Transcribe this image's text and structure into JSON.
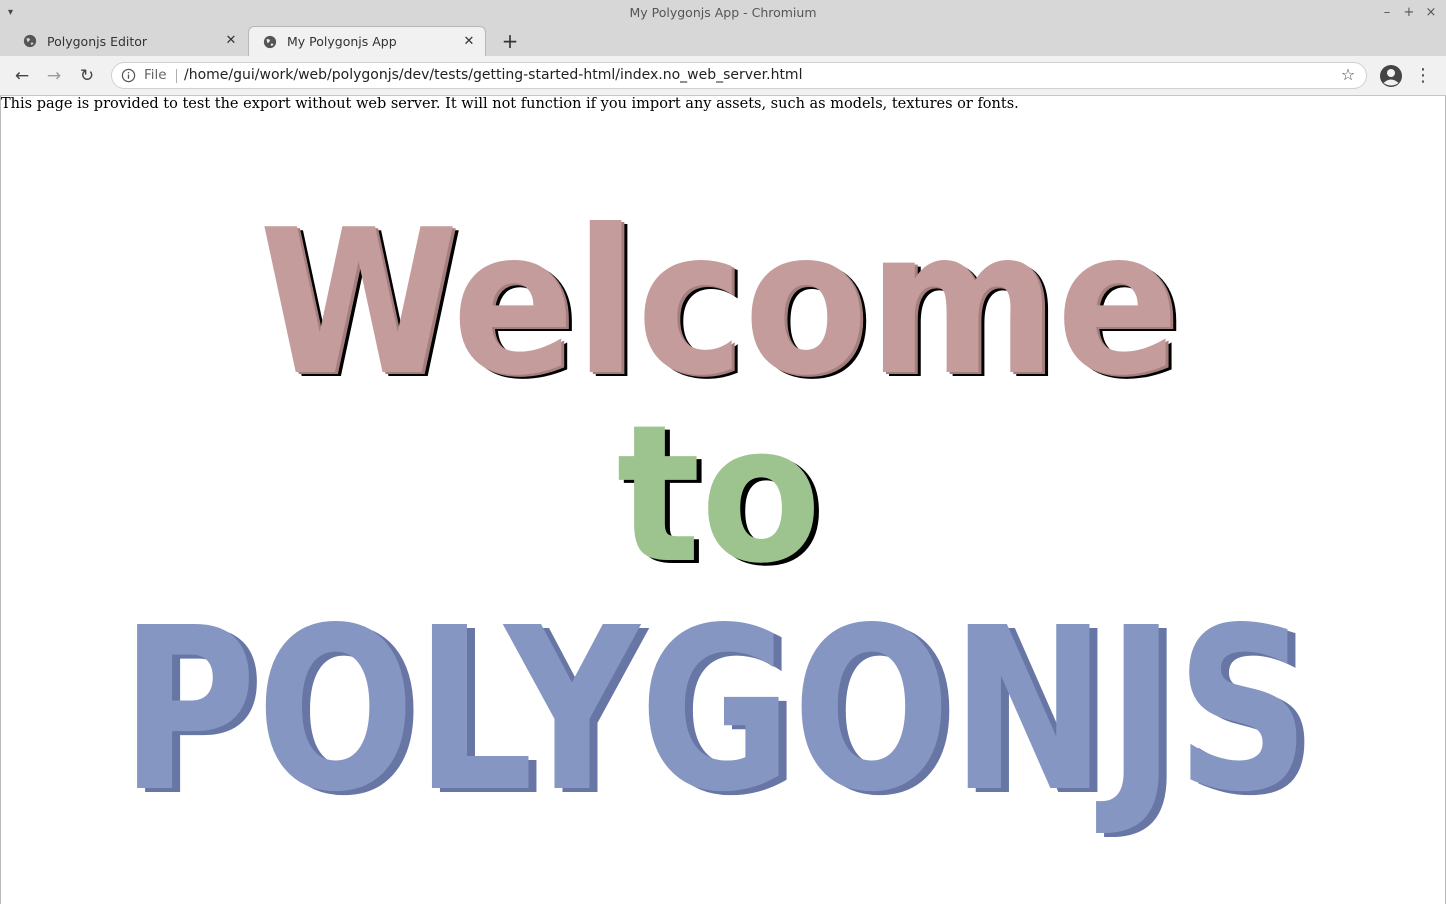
{
  "window": {
    "title": "My Polygonjs App - Chromium"
  },
  "tabs": [
    {
      "label": "Polygonjs Editor",
      "active": false
    },
    {
      "label": "My Polygonjs App",
      "active": true
    }
  ],
  "address_bar": {
    "scheme_label": "File",
    "url": "/home/gui/work/web/polygonjs/dev/tests/getting-started-html/index.no_web_server.html"
  },
  "page": {
    "notice": "This page is provided to test the export without web server. It will not function if you import any assets, such as models, textures or fonts.",
    "scene_words": [
      {
        "text": "Welcome",
        "color": "#c49c9c",
        "side": "#a57e7e"
      },
      {
        "text": "to",
        "color": "#9dc48f",
        "side": "#7ea470"
      },
      {
        "text": "POLYGONJS",
        "color": "#8696c2",
        "side": "#6776a5"
      }
    ]
  },
  "icons": {
    "back": "arrow-left-icon",
    "forward": "arrow-right-icon",
    "reload": "reload-icon",
    "info": "info-icon",
    "star": "star-icon",
    "profile": "profile-icon",
    "menu": "three-dots-icon",
    "tab_favicon": "globe-icon",
    "close": "close-icon",
    "new_tab": "plus-icon"
  }
}
